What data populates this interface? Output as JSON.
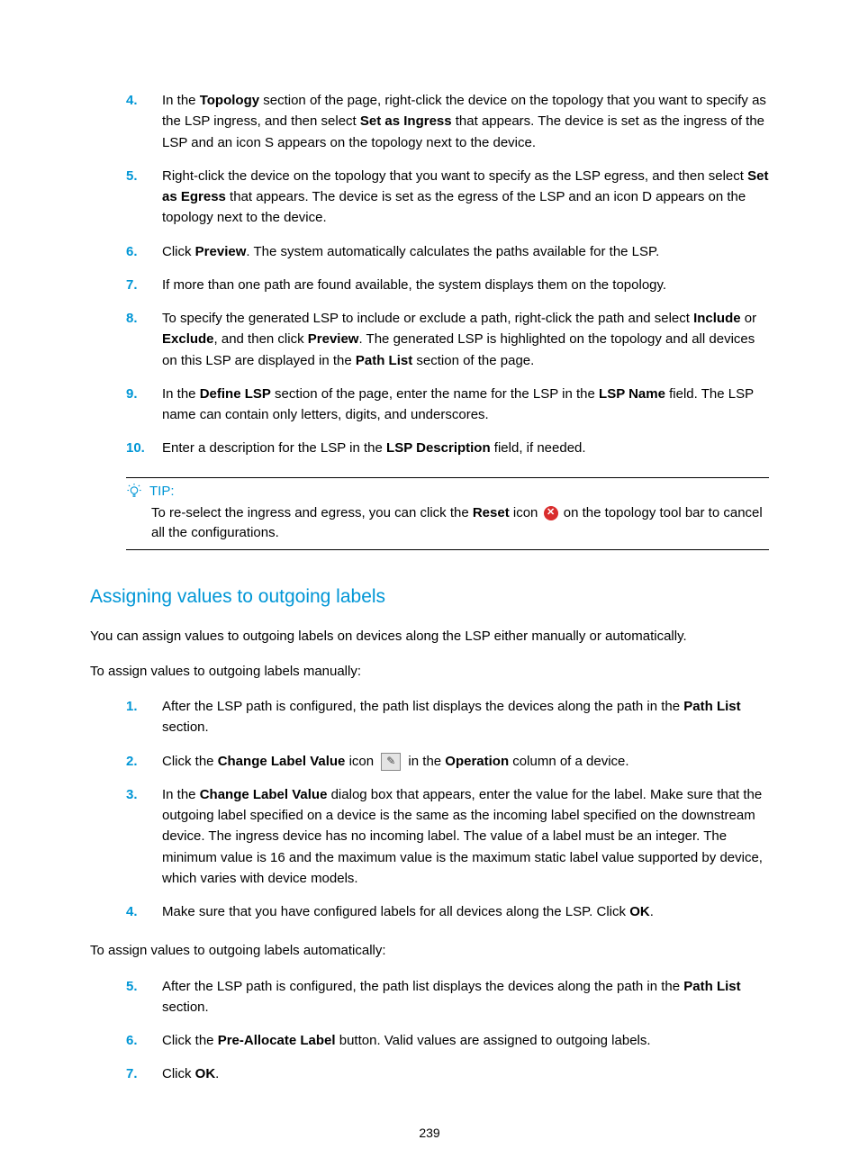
{
  "steps_a": [
    {
      "n": "4.",
      "parts": [
        "In the ",
        {
          "b": "Topology"
        },
        " section of the page, right-click the device on the topology that you want to specify as the LSP ingress, and then select ",
        {
          "b": "Set as Ingress"
        },
        " that appears. The device is set as the ingress of the LSP and an icon S appears on the topology next to the device."
      ]
    },
    {
      "n": "5.",
      "parts": [
        "Right-click the device on the topology that you want to specify as the LSP egress, and then select ",
        {
          "b": "Set as Egress"
        },
        " that appears. The device is set as the egress of the LSP and an icon D appears on the topology next to the device."
      ]
    },
    {
      "n": "6.",
      "parts": [
        "Click ",
        {
          "b": "Preview"
        },
        ". The system automatically calculates the paths available for the LSP."
      ]
    },
    {
      "n": "7.",
      "parts": [
        "If more than one path are found available, the system displays them on the topology."
      ]
    },
    {
      "n": "8.",
      "parts": [
        "To specify the generated LSP to include or exclude a path, right-click the path and select ",
        {
          "b": "Include"
        },
        " or ",
        {
          "b": "Exclude"
        },
        ", and then click ",
        {
          "b": "Preview"
        },
        ". The generated LSP is highlighted on the topology and all devices on this LSP are displayed in the ",
        {
          "b": "Path List"
        },
        " section of the page."
      ]
    },
    {
      "n": "9.",
      "parts": [
        "In the ",
        {
          "b": "Define LSP"
        },
        " section of the page, enter the name for the LSP in the ",
        {
          "b": "LSP Name"
        },
        " field. The LSP name can contain only letters, digits, and underscores."
      ]
    },
    {
      "n": "10.",
      "parts": [
        "Enter a description for the LSP in the ",
        {
          "b": "LSP Description"
        },
        " field, if needed."
      ]
    }
  ],
  "tip": {
    "label": "TIP:",
    "parts": [
      "To re-select the ingress and egress, you can click the ",
      {
        "b": "Reset"
      },
      " icon ",
      {
        "icon": "reset"
      },
      " on the topology tool bar to cancel all the configurations."
    ]
  },
  "section_title": "Assigning values to outgoing labels",
  "para1": "You can assign values to outgoing labels on devices along the LSP either manually or automatically.",
  "para2": "To assign values to outgoing labels manually:",
  "steps_b": [
    {
      "n": "1.",
      "parts": [
        "After the LSP path is configured, the path list displays the devices along the path in the ",
        {
          "b": "Path List"
        },
        " section."
      ]
    },
    {
      "n": "2.",
      "parts": [
        "Click the ",
        {
          "b": "Change Label Value"
        },
        " icon ",
        {
          "icon": "edit"
        },
        " in the ",
        {
          "b": "Operation"
        },
        " column of a device."
      ]
    },
    {
      "n": "3.",
      "parts": [
        "In the ",
        {
          "b": "Change Label Value"
        },
        " dialog box that appears, enter the value for the label. Make sure that the outgoing label specified on a device is the same as the incoming label specified on the downstream device. The ingress device has no incoming label. The value of a label must be an integer. The minimum value is 16 and the maximum value is the maximum static label value supported by device, which varies with device models."
      ]
    },
    {
      "n": "4.",
      "parts": [
        "Make sure that you have configured labels for all devices along the LSP. Click ",
        {
          "b": "OK"
        },
        "."
      ]
    }
  ],
  "para3": "To assign values to outgoing labels automatically:",
  "steps_c": [
    {
      "n": "5.",
      "parts": [
        "After the LSP path is configured, the path list displays the devices along the path in the ",
        {
          "b": "Path List"
        },
        " section."
      ]
    },
    {
      "n": "6.",
      "parts": [
        "Click the ",
        {
          "b": "Pre-Allocate Label"
        },
        " button. Valid values are assigned to outgoing labels."
      ]
    },
    {
      "n": "7.",
      "parts": [
        "Click ",
        {
          "b": "OK"
        },
        "."
      ]
    }
  ],
  "page_number": "239"
}
